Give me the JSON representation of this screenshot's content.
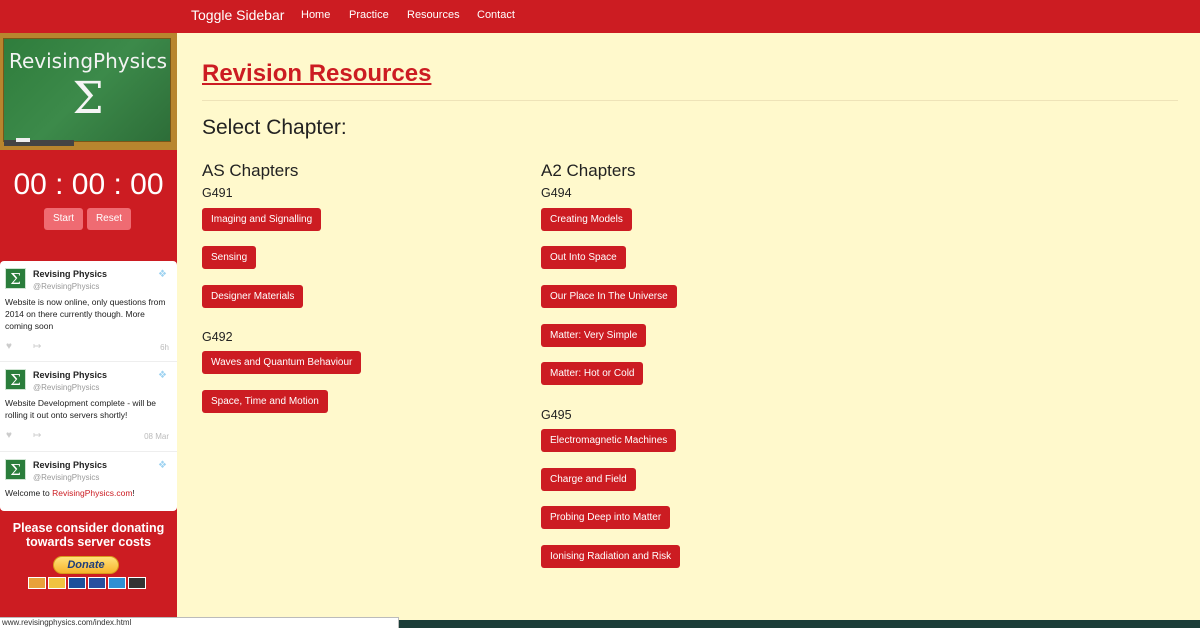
{
  "navbar": {
    "brand": "Toggle Sidebar",
    "links": [
      "Home",
      "Practice",
      "Resources",
      "Contact"
    ]
  },
  "sidebar": {
    "logo_title": "RevisingPhysics",
    "logo_symbol": "Σ",
    "timer": {
      "display": "00 : 00 : 00",
      "start": "Start",
      "reset": "Reset"
    },
    "tweets": [
      {
        "name": "Revising Physics",
        "handle": "@RevisingPhysics",
        "text": "Website is now online, only questions from 2014 on there currently though. More coming soon",
        "time": "6h"
      },
      {
        "name": "Revising Physics",
        "handle": "@RevisingPhysics",
        "text": "Website Development complete - will be rolling it out onto servers shortly!",
        "time": "08 Mar"
      },
      {
        "name": "Revising Physics",
        "handle": "@RevisingPhysics",
        "text_prefix": "Welcome to ",
        "link": "RevisingPhysics.com",
        "text_suffix": "!"
      }
    ],
    "donate": {
      "message": "Please consider donating towards server costs",
      "button": "Donate"
    }
  },
  "status_url": "www.revisingphysics.com/index.html",
  "main": {
    "title": "Revision Resources",
    "subtitle": "Select Chapter:",
    "as": {
      "heading": "AS Chapters",
      "g491": {
        "code": "G491",
        "chapters": [
          "Imaging and Signalling",
          "Sensing",
          "Designer Materials"
        ]
      },
      "g492": {
        "code": "G492",
        "chapters": [
          "Waves and Quantum Behaviour",
          "Space, Time and Motion"
        ]
      }
    },
    "a2": {
      "heading": "A2 Chapters",
      "g494": {
        "code": "G494",
        "chapters": [
          "Creating Models",
          "Out Into Space",
          "Our Place In The Universe",
          "Matter: Very Simple",
          "Matter: Hot or Cold"
        ]
      },
      "g495": {
        "code": "G495",
        "chapters": [
          "Electromagnetic Machines",
          "Charge and Field",
          "Probing Deep into Matter",
          "Ionising Radiation and Risk"
        ]
      }
    }
  },
  "colors": {
    "brand_red": "#cc1c22",
    "page_bg": "#fff9cc",
    "chalkboard": "#2f7d3c"
  }
}
